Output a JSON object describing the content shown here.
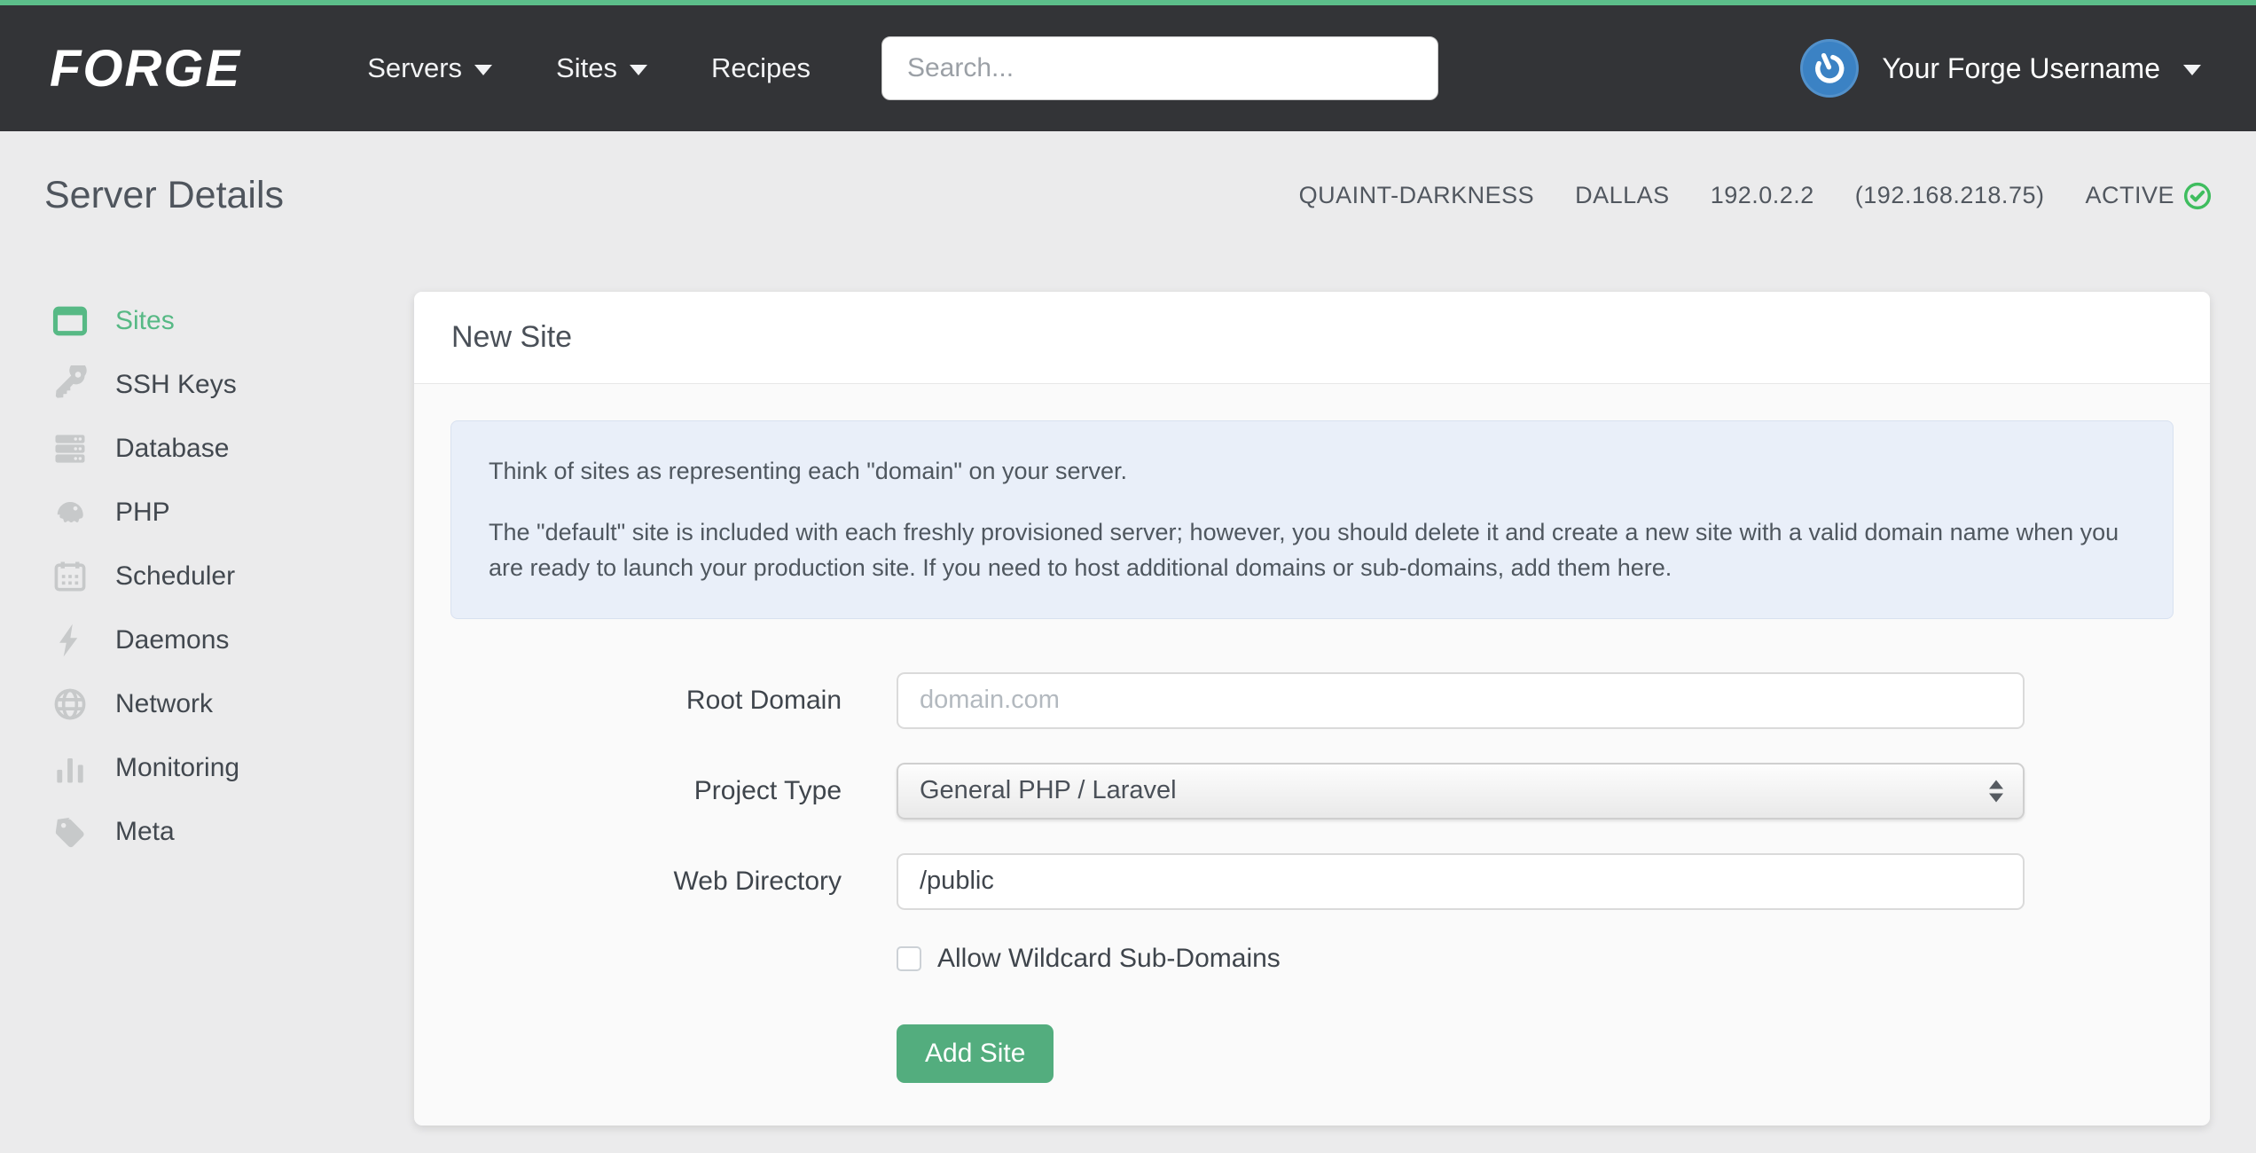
{
  "navbar": {
    "logo": "FORGE",
    "items": [
      {
        "label": "Servers"
      },
      {
        "label": "Sites"
      },
      {
        "label": "Recipes"
      }
    ],
    "search_placeholder": "Search...",
    "user": {
      "name": "Your Forge Username"
    }
  },
  "header": {
    "title": "Server Details",
    "meta": {
      "server_name": "QUAINT-DARKNESS",
      "region": "DALLAS",
      "ip": "192.0.2.2",
      "private_ip": "(192.168.218.75)",
      "status": "ACTIVE"
    }
  },
  "sidebar": {
    "active_item": "Sites",
    "items": [
      {
        "label": "Sites",
        "icon": "window-icon"
      },
      {
        "label": "SSH Keys",
        "icon": "key-icon"
      },
      {
        "label": "Database",
        "icon": "database-icon"
      },
      {
        "label": "PHP",
        "icon": "elephant-icon"
      },
      {
        "label": "Scheduler",
        "icon": "calendar-icon"
      },
      {
        "label": "Daemons",
        "icon": "lightning-icon"
      },
      {
        "label": "Network",
        "icon": "globe-icon"
      },
      {
        "label": "Monitoring",
        "icon": "bar-chart-icon"
      },
      {
        "label": "Meta",
        "icon": "tag-icon"
      }
    ]
  },
  "card": {
    "title": "New Site",
    "info": {
      "paragraph_1": "Think of sites as representing each \"domain\" on your server.",
      "paragraph_2": "The \"default\" site is included with each freshly provisioned server; however, you should delete it and create a new site with a valid domain name when you are ready to launch your production site. If you need to host additional domains or sub-domains, add them here."
    },
    "form": {
      "root_domain": {
        "label": "Root Domain",
        "placeholder": "domain.com",
        "value": ""
      },
      "project_type": {
        "label": "Project Type",
        "value": "General PHP / Laravel"
      },
      "web_directory": {
        "label": "Web Directory",
        "value": "/public"
      },
      "wildcard_checkbox": {
        "label": "Allow Wildcard Sub-Domains",
        "checked": false
      },
      "submit_label": "Add Site"
    }
  },
  "colors": {
    "topbar_green": "#5cbe8a",
    "navbar_bg": "#333437",
    "brand_green": "#57b985",
    "button_green": "#53ad7e",
    "status_green": "#3fbd5f",
    "avatar_blue": "#3b82c4",
    "info_bg": "#e9eff9",
    "page_bg": "#ebebec"
  }
}
